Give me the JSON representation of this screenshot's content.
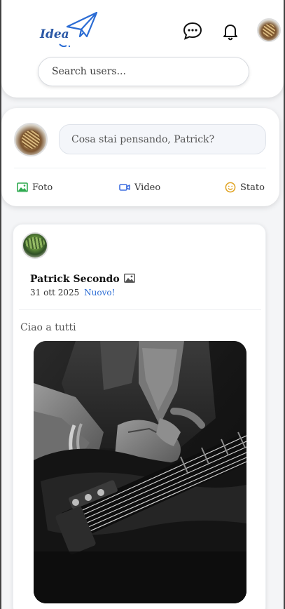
{
  "header": {
    "logo_text": "Idea",
    "search_placeholder": "Search users..."
  },
  "composer": {
    "placeholder": "Cosa stai pensando, Patrick?",
    "actions": [
      {
        "label": "Foto",
        "icon": "photo-icon",
        "color": "#2eaa4f"
      },
      {
        "label": "Video",
        "icon": "video-icon",
        "color": "#3f6fe0"
      },
      {
        "label": "Stato",
        "icon": "smile-icon",
        "color": "#e0a21f"
      }
    ]
  },
  "post": {
    "author": "Patrick Secondo",
    "date": "31 ott 2025",
    "badge": "Nuovo!",
    "text": "Ciao a tutti",
    "image_alt": "guitar-player-photo"
  },
  "colors": {
    "brand_blue": "#2b58a6",
    "link_blue": "#2b6cd4"
  }
}
